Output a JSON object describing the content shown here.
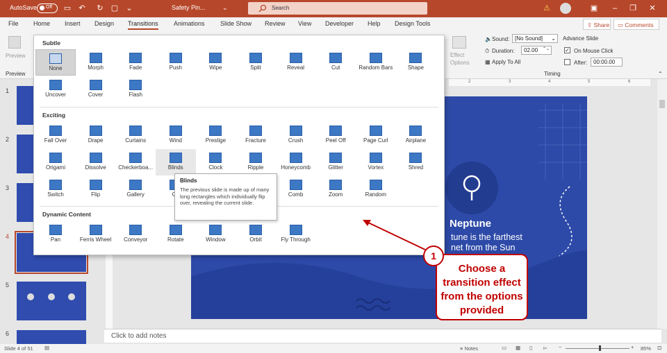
{
  "titlebar": {
    "autosave": "AutoSave",
    "autosave_state": "Off",
    "doc_name": "Safety Pin...",
    "search_placeholder": "Search"
  },
  "menu": {
    "file": "File",
    "home": "Home",
    "insert": "Insert",
    "design": "Design",
    "transitions": "Transitions",
    "animations": "Animations",
    "slideshow": "Slide Show",
    "review": "Review",
    "view": "View",
    "developer": "Developer",
    "help": "Help",
    "designtools": "Design Tools",
    "share": "Share",
    "comments": "Comments"
  },
  "ribbon": {
    "preview": "Preview",
    "preview_group": "Preview",
    "effect_options": "Effect\nOptions",
    "sound_label": "Sound:",
    "sound_value": "[No Sound]",
    "duration_label": "Duration:",
    "duration_value": "02.00",
    "apply_all": "Apply To All",
    "advance_slide": "Advance Slide",
    "on_mouse_click": "On Mouse Click",
    "after": "After:",
    "after_value": "00:00.00",
    "timing_group": "Timing"
  },
  "gallery": {
    "subtle_title": "Subtle",
    "subtle": [
      "None",
      "Morph",
      "Fade",
      "Push",
      "Wipe",
      "Split",
      "Reveal",
      "Cut",
      "Random Bars",
      "Shape",
      "Uncover",
      "Cover",
      "Flash"
    ],
    "exciting_title": "Exciting",
    "exciting": [
      "Fall Over",
      "Drape",
      "Curtains",
      "Wind",
      "Prestige",
      "Fracture",
      "Crush",
      "Peel Off",
      "Page Curl",
      "Airplane",
      "Origami",
      "Dissolve",
      "Checkerboa...",
      "Blinds",
      "Clock",
      "Ripple",
      "Honeycomb",
      "Glitter",
      "Vortex",
      "Shred",
      "Switch",
      "Flip",
      "Gallery",
      "Cu",
      "",
      "",
      "Comb",
      "Zoom",
      "Random"
    ],
    "dynamic_title": "Dynamic Content",
    "dynamic": [
      "Pan",
      "Ferris Wheel",
      "Conveyor",
      "Rotate",
      "Window",
      "Orbit",
      "Fly Through"
    ]
  },
  "tooltip": {
    "title": "Blinds",
    "body": "The previous slide is made up of many long rectangles which individually flip over, revealing the current slide."
  },
  "slide": {
    "title": "Neptune",
    "line1": "tune is the farthest",
    "line2": "net from the Sun"
  },
  "thumbnails": [
    "1",
    "2",
    "3",
    "4",
    "5",
    "6"
  ],
  "notes_placeholder": "Click to add notes",
  "status": {
    "slide_of": "Slide 4 of 51",
    "notes": "Notes",
    "zoom": "85%"
  },
  "callout": {
    "number": "1",
    "text": "Choose a transition effect from the options provided"
  },
  "colors": {
    "accent": "#b7472a",
    "slide": "#2d4aa8",
    "callout": "#c00000"
  }
}
